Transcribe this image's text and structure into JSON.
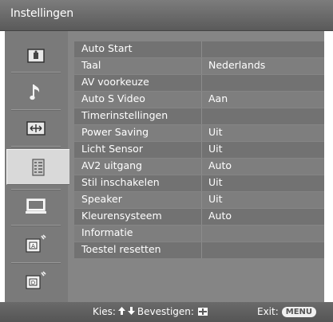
{
  "window": {
    "title": "Instellingen"
  },
  "sidebar": {
    "items": [
      {
        "icon": "picture-icon"
      },
      {
        "icon": "music-note-icon"
      },
      {
        "icon": "screen-format-icon"
      },
      {
        "icon": "settings-list-icon",
        "selected": true
      },
      {
        "icon": "pc-monitor-icon"
      },
      {
        "icon": "analog-antenna-icon"
      },
      {
        "icon": "digital-antenna-icon"
      }
    ]
  },
  "menu": {
    "rows": [
      {
        "label": "Auto Start",
        "value": ""
      },
      {
        "label": "Taal",
        "value": "Nederlands"
      },
      {
        "label": "AV voorkeuze",
        "value": ""
      },
      {
        "label": "Auto S Video",
        "value": "Aan"
      },
      {
        "label": "Timerinstellingen",
        "value": ""
      },
      {
        "label": "Power Saving",
        "value": "Uit"
      },
      {
        "label": "Licht Sensor",
        "value": "Uit"
      },
      {
        "label": "AV2 uitgang",
        "value": "Auto"
      },
      {
        "label": "Stil inschakelen",
        "value": "Uit"
      },
      {
        "label": "Speaker",
        "value": "Uit"
      },
      {
        "label": "Kleurensysteem",
        "value": "Auto"
      },
      {
        "label": "Informatie",
        "value": ""
      },
      {
        "label": "Toestel resetten",
        "value": ""
      }
    ]
  },
  "footer": {
    "select_label": "Kies:",
    "confirm_label": "Bevestigen:",
    "exit_label": "Exit:",
    "menu_button": "MENU"
  },
  "colors": {
    "title_bar": "#6b6b6b",
    "panel": "#858585",
    "row_dark": "#727272",
    "row_light": "#7e7e7e",
    "selected_tab": "#d9d9d9",
    "text": "#ffffff"
  }
}
